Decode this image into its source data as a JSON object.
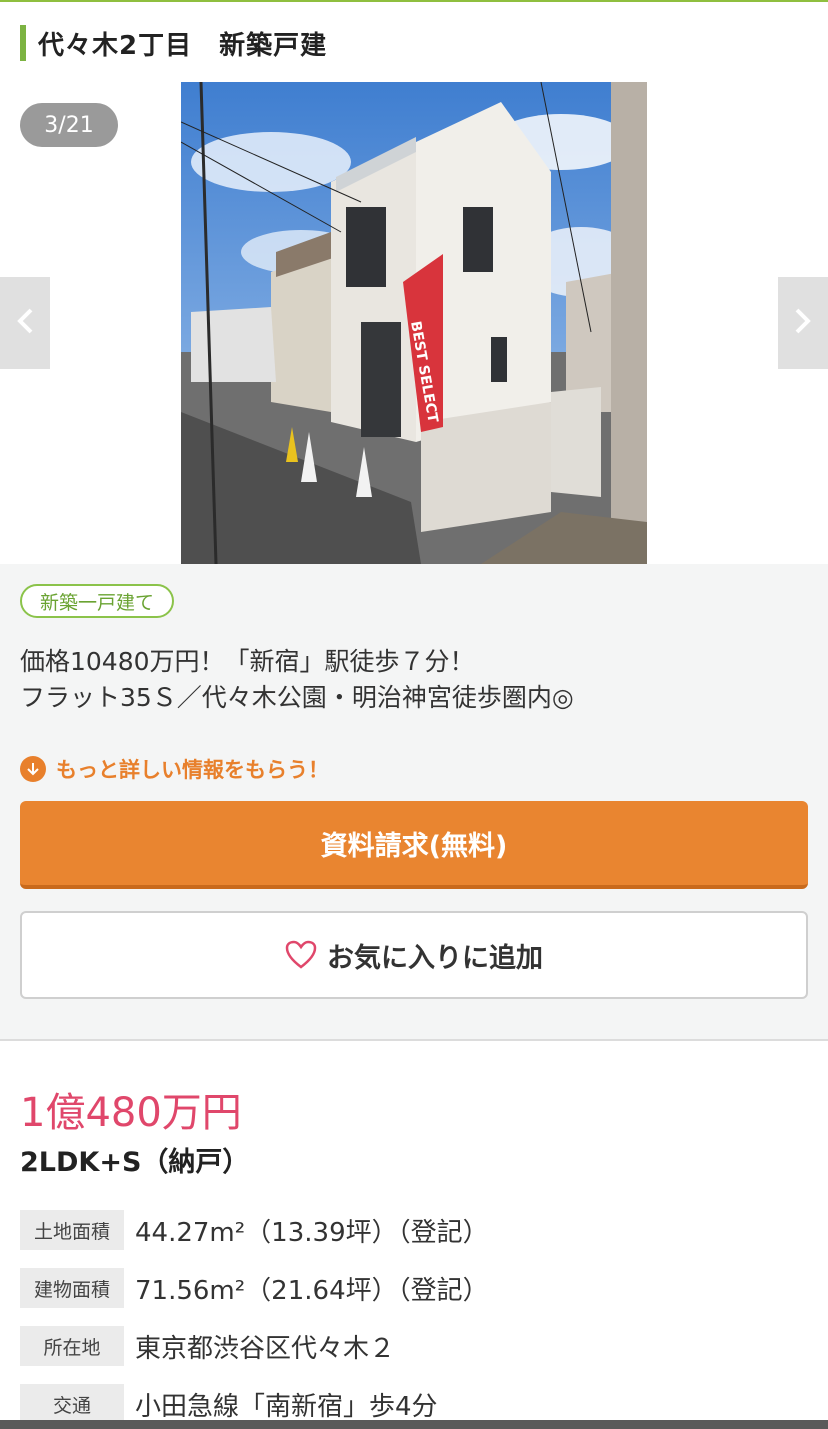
{
  "listing": {
    "title": "代々木2丁目　新築戸建"
  },
  "gallery": {
    "counter": "3/21",
    "photo_subject": "three-story white detached house with red BEST SELECT banner flag",
    "banner_text": "BEST SELECT",
    "prev_icon": "chevron-left-icon",
    "next_icon": "chevron-right-icon"
  },
  "info": {
    "badge": "新築一戸建て",
    "catch_line1": "価格10480万円！「新宿」駅徒歩７分！",
    "catch_line2": "フラット35Ｓ／代々木公園・明治神宮徒歩圏内◎",
    "more_label": "もっと詳しい情報をもらう！",
    "request_button": "資料請求(無料)",
    "favorite_button": "お気に入りに追加"
  },
  "details": {
    "price": "1億480万円",
    "layout": "2LDK+S（納戸）",
    "specs": [
      {
        "label": "土地面積",
        "value": "44.27m²（13.39坪）（登記）"
      },
      {
        "label": "建物面積",
        "value": "71.56m²（21.64坪）（登記）"
      },
      {
        "label": "所在地",
        "value": "東京都渋谷区代々木２"
      },
      {
        "label": "交通",
        "value": "小田急線「南新宿」歩4分"
      }
    ]
  },
  "colors": {
    "accent_green": "#7cb342",
    "price_pink": "#e0476b",
    "cta_orange": "#e98530"
  }
}
